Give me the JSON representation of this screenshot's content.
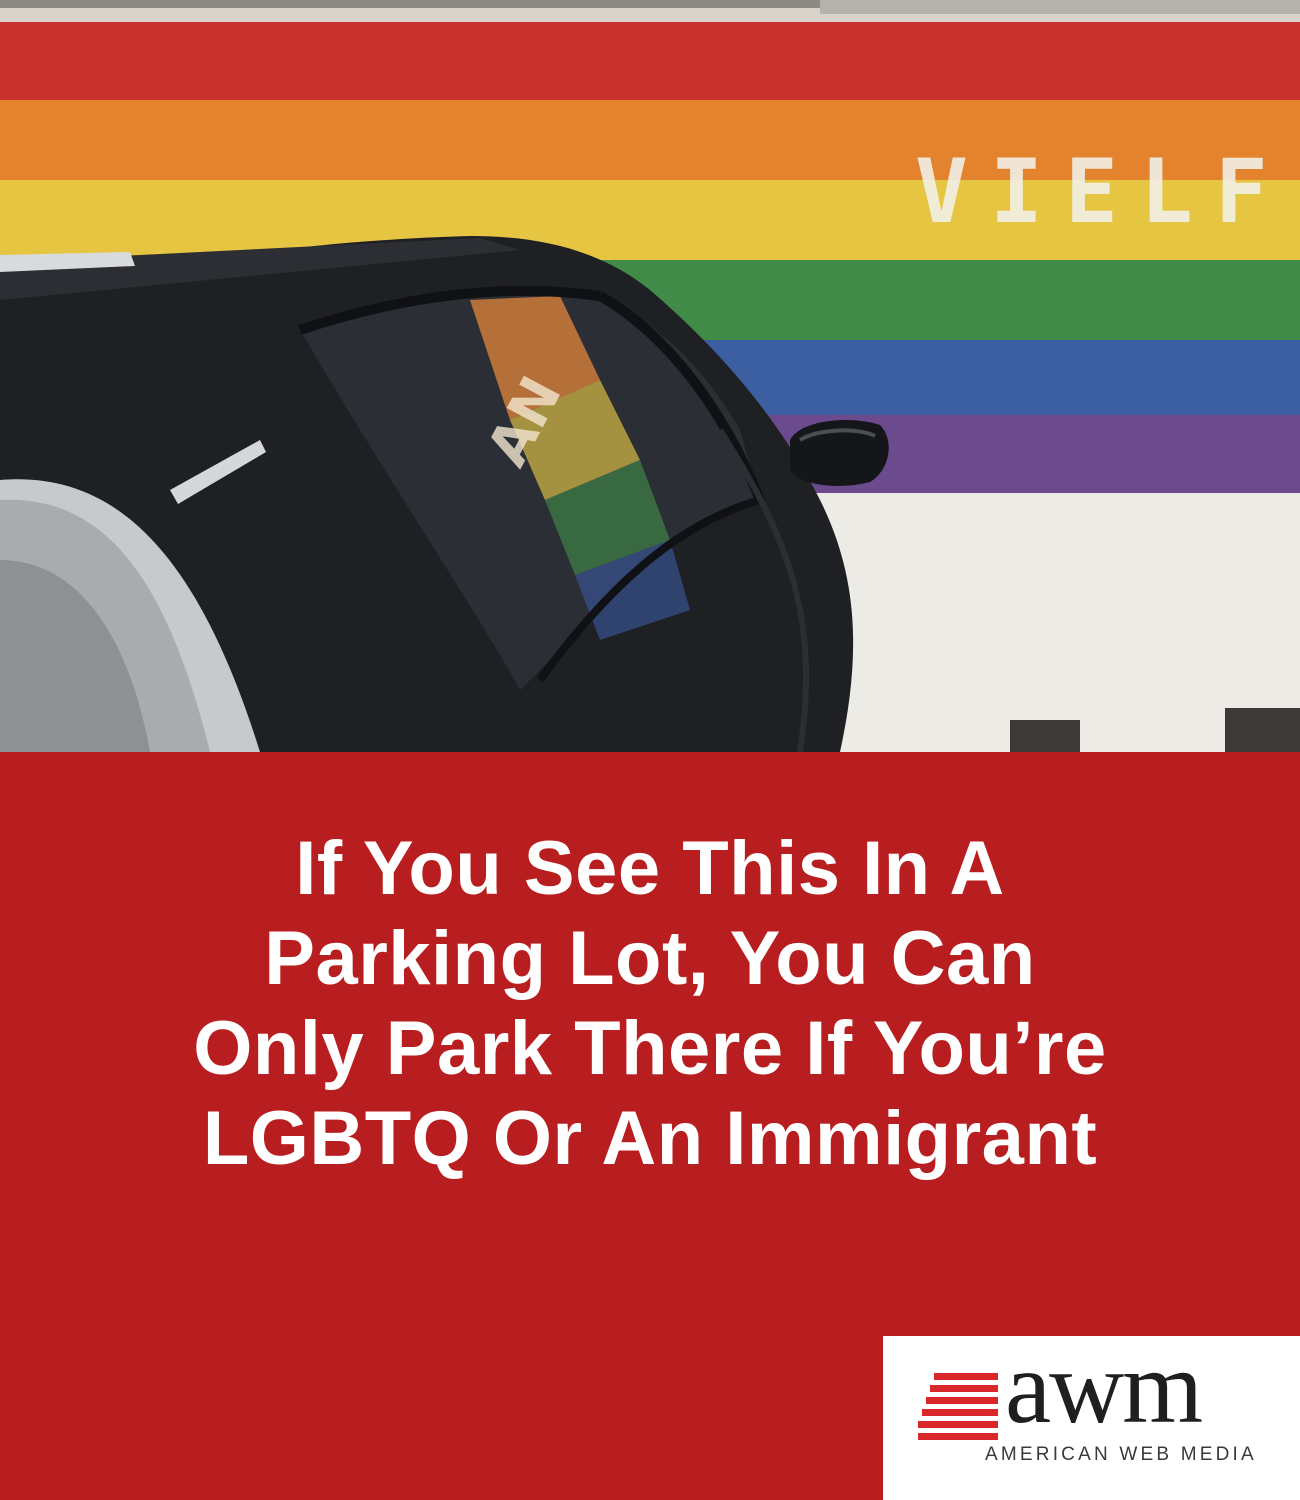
{
  "photo": {
    "wall_lettering": "VIELF",
    "car_window_reflection": "AN",
    "stripe_colors": [
      "#c9332f",
      "#e3832d",
      "#e6c542",
      "#3f8b47",
      "#3b5fa0",
      "#6c4a8e"
    ]
  },
  "headline": {
    "lines": [
      "If You See This In A",
      "Parking Lot, You Can",
      "Only Park There If You’re",
      "LGBTQ Or An Immigrant"
    ],
    "color": "#ffffff",
    "background": "#b81e1f"
  },
  "logo": {
    "wordmark": "awm",
    "tagline": "AMERICAN WEB MEDIA",
    "stripe_color": "#d8262a"
  }
}
